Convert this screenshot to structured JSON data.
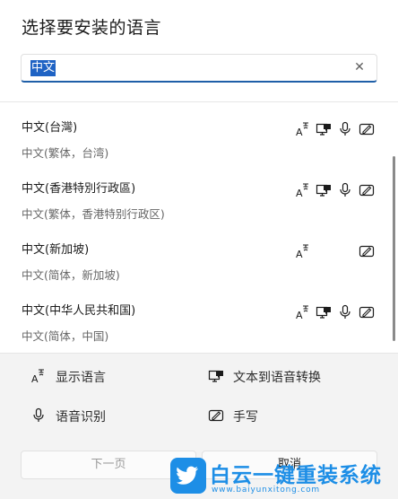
{
  "dialog": {
    "title": "选择要安装的语言",
    "search": {
      "value": "中文",
      "placeholder": "",
      "clear_glyph": "✕"
    },
    "languages": [
      {
        "name": "中文(台灣)",
        "sub": "中文(繁体，台湾)",
        "features": [
          "display-language-icon",
          "text-to-speech-icon",
          "speech-recognition-icon",
          "handwriting-icon"
        ]
      },
      {
        "name": "中文(香港特別行政區)",
        "sub": "中文(繁体，香港特别行政区)",
        "features": [
          "display-language-icon",
          "text-to-speech-icon",
          "speech-recognition-icon",
          "handwriting-icon"
        ]
      },
      {
        "name": "中文(新加坡)",
        "sub": "中文(简体，新加坡)",
        "features": [
          "display-language-icon",
          "handwriting-icon"
        ]
      },
      {
        "name": "中文(中华人民共和国)",
        "sub": "中文(简体，中国)",
        "features": [
          "display-language-icon",
          "text-to-speech-icon",
          "speech-recognition-icon",
          "handwriting-icon"
        ]
      }
    ],
    "legend": {
      "display_language": "显示语言",
      "text_to_speech": "文本到语音转换",
      "speech_recognition": "语音识别",
      "handwriting": "手写"
    },
    "buttons": {
      "next": "下一页",
      "cancel": "取消"
    },
    "watermark": {
      "title": "白云一键重装系统",
      "url": "www.baiyunxitong.com"
    },
    "colors": {
      "accent": "#1f5fa8",
      "selection": "#1f63c4",
      "watermark": "#1d8ee6"
    }
  }
}
